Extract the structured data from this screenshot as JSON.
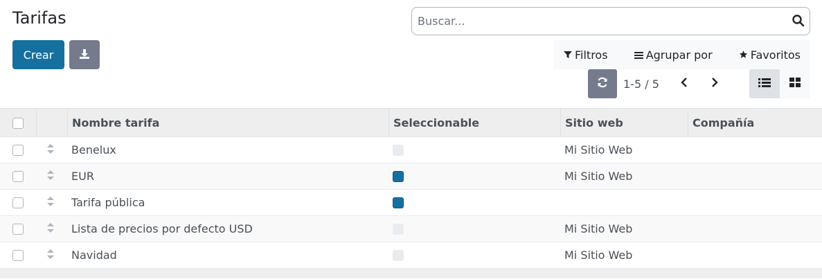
{
  "page": {
    "title": "Tarifas"
  },
  "search": {
    "placeholder": "Buscar..."
  },
  "toolbar": {
    "create_label": "Crear"
  },
  "filters": {
    "filter_label": "Filtros",
    "group_label": "Agrupar por",
    "favorites_label": "Favoritos"
  },
  "pager": {
    "value": "1-5 / 5"
  },
  "view": {
    "active": "list"
  },
  "colors": {
    "accent": "#1570a0",
    "secondary": "#757b8d"
  },
  "table": {
    "columns": [
      "Nombre tarifa",
      "Seleccionable",
      "Sitio web",
      "Compañía"
    ],
    "rows": [
      {
        "name": "Benelux",
        "selectable": false,
        "website": "Mi Sitio Web",
        "company": ""
      },
      {
        "name": "EUR",
        "selectable": true,
        "website": "Mi Sitio Web",
        "company": ""
      },
      {
        "name": "Tarifa pública",
        "selectable": true,
        "website": "",
        "company": ""
      },
      {
        "name": "Lista de precios por defecto USD",
        "selectable": false,
        "website": "Mi Sitio Web",
        "company": ""
      },
      {
        "name": "Navidad",
        "selectable": false,
        "website": "Mi Sitio Web",
        "company": ""
      }
    ]
  }
}
